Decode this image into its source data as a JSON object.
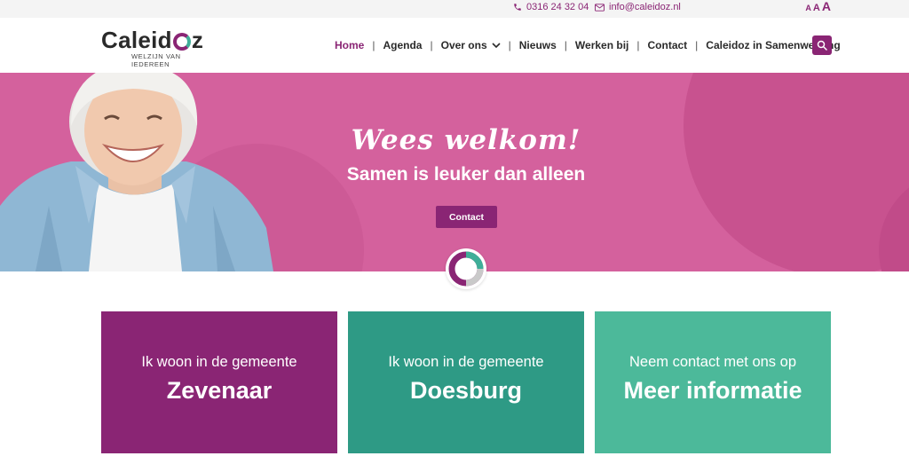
{
  "topbar": {
    "phone": "0316 24 32 04",
    "email": "info@caleidoz.nl",
    "font_sizes": [
      "A",
      "A",
      "A"
    ]
  },
  "logo": {
    "pre": "Caleid",
    "post": "z",
    "tagline": "WELZIJN VAN IEDEREEN"
  },
  "nav": {
    "items": [
      "Home",
      "Agenda",
      "Over ons",
      "Nieuws",
      "Werken bij",
      "Contact",
      "Caleidoz in Samenwerking"
    ],
    "active": "Home"
  },
  "hero": {
    "title": "Wees welkom!",
    "subtitle": "Samen is leuker dan alleen",
    "button": "Contact"
  },
  "cards": [
    {
      "pre": "Ik woon in de gemeente",
      "main": "Zevenaar",
      "color": "#8a2574"
    },
    {
      "pre": "Ik woon in de gemeente",
      "main": "Doesburg",
      "color": "#2e9a85"
    },
    {
      "pre": "Neem contact met ons op",
      "main": "Meer informatie",
      "color": "#4cb99a"
    }
  ],
  "colors": {
    "brand_purple": "#8a2574",
    "hero_pink": "#d4619d",
    "teal": "#3fae98"
  },
  "icons": [
    "phone-icon",
    "mail-icon",
    "search-icon",
    "chevron-down-icon",
    "caleidoz-badge-icon"
  ]
}
